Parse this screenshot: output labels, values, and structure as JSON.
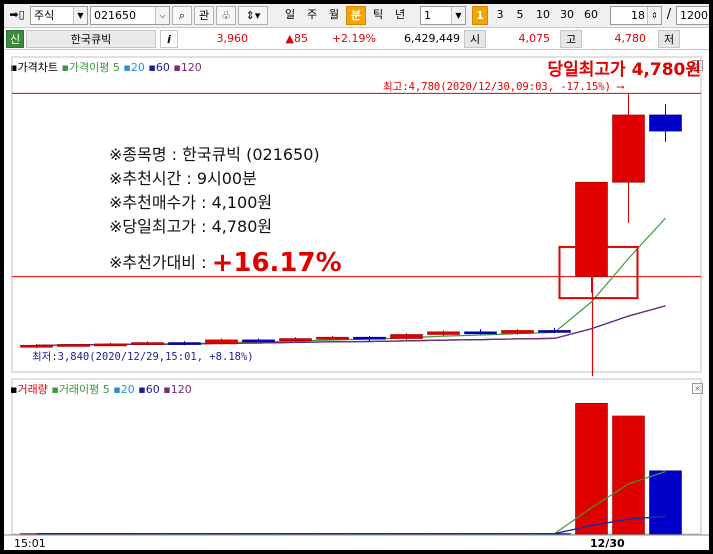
{
  "toolbar": {
    "market_select": "주식",
    "code_input": "021650",
    "view_btn": "관",
    "periods": [
      "일",
      "주",
      "월",
      "분",
      "틱",
      "년"
    ],
    "active_period": "분",
    "interval_select": "1",
    "intervals": [
      "1",
      "3",
      "5",
      "10",
      "30",
      "60"
    ],
    "active_interval": "1",
    "count_input": "18",
    "slash": "/",
    "total_input": "1200"
  },
  "quote": {
    "new_label": "신",
    "name": "한국큐빅",
    "info_icon": "i",
    "price": "3,960",
    "change": "▲85",
    "change_pct": "+2.19%",
    "volume": "6,429,449",
    "open_label": "시",
    "open": "4,075",
    "high_label": "고",
    "high": "4,780",
    "low_label": "저"
  },
  "price_pane": {
    "legend_main": "가격차트",
    "legend_ma": "가격이평",
    "ma_periods": [
      "5",
      "20",
      "60",
      "120"
    ],
    "high_title": "당일최고가 4,780원",
    "high_sub": "최고:4,780(2020/12/30,09:03, -17.15%)",
    "low_sub": "최저:3,840(2020/12/29,15:01, +8.18%)"
  },
  "info_box": {
    "line1": "※종목명 : 한국큐빅 (021650)",
    "line2": "※추천시간 : 9시00분",
    "line3": "※추천매수가 : 4,100원",
    "line4": "※당일최고가 : 4,780원",
    "line5_label": "※추천가대비 : ",
    "line5_value": "+16.17%"
  },
  "volume_pane": {
    "legend_main": "거래량",
    "legend_ma": "거래이평",
    "ma_periods": [
      "5",
      "20",
      "60",
      "120"
    ]
  },
  "x_axis": {
    "left_time": "15:01",
    "right_date": "12/30"
  },
  "chart_data": {
    "type": "candlestick",
    "price_candles": [
      {
        "open": 3840,
        "high": 3850,
        "low": 3835,
        "close": 3845,
        "dir": "up"
      },
      {
        "open": 3845,
        "high": 3850,
        "low": 3840,
        "close": 3848,
        "dir": "up"
      },
      {
        "open": 3848,
        "high": 3855,
        "low": 3845,
        "close": 3850,
        "dir": "up"
      },
      {
        "open": 3850,
        "high": 3860,
        "low": 3845,
        "close": 3855,
        "dir": "up"
      },
      {
        "open": 3855,
        "high": 3860,
        "low": 3845,
        "close": 3850,
        "dir": "down"
      },
      {
        "open": 3850,
        "high": 3870,
        "low": 3848,
        "close": 3865,
        "dir": "up"
      },
      {
        "open": 3865,
        "high": 3870,
        "low": 3860,
        "close": 3862,
        "dir": "down"
      },
      {
        "open": 3862,
        "high": 3875,
        "low": 3860,
        "close": 3870,
        "dir": "up"
      },
      {
        "open": 3870,
        "high": 3880,
        "low": 3865,
        "close": 3875,
        "dir": "up"
      },
      {
        "open": 3875,
        "high": 3880,
        "low": 3860,
        "close": 3870,
        "dir": "down"
      },
      {
        "open": 3870,
        "high": 3890,
        "low": 3865,
        "close": 3885,
        "dir": "up"
      },
      {
        "open": 3885,
        "high": 3900,
        "low": 3880,
        "close": 3895,
        "dir": "up"
      },
      {
        "open": 3895,
        "high": 3905,
        "low": 3885,
        "close": 3890,
        "dir": "down"
      },
      {
        "open": 3890,
        "high": 3905,
        "low": 3885,
        "close": 3900,
        "dir": "up"
      },
      {
        "open": 3900,
        "high": 3910,
        "low": 3890,
        "close": 3895,
        "dir": "down"
      },
      {
        "open": 4100,
        "high": 4150,
        "low": 4040,
        "close": 4450,
        "dir": "up"
      },
      {
        "open": 4450,
        "high": 4780,
        "low": 4300,
        "close": 4700,
        "dir": "up"
      },
      {
        "open": 4700,
        "high": 4740,
        "low": 4600,
        "close": 4640,
        "dir": "down"
      }
    ],
    "volume": [
      2,
      2,
      1,
      1,
      2,
      1,
      2,
      1,
      1,
      2,
      2,
      1,
      2,
      1,
      2,
      620,
      560,
      300
    ],
    "reference_price": 4100,
    "high_price": 4780,
    "low_price": 3840
  }
}
